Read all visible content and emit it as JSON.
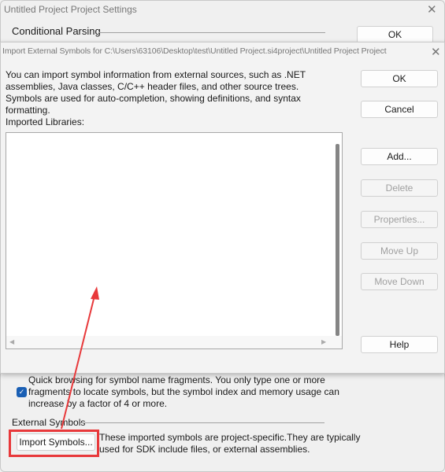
{
  "back_dialog": {
    "title": "Untitled Project Project Settings",
    "section_conditional": "Conditional Parsing",
    "ok": "OK",
    "quick_browse_text": "Quick browsing for symbol name fragments.  You only type one or more fragments to locate symbols, but the symbol index and memory usage can increase by a factor of 4 or more.",
    "quick_browse_checked": true,
    "section_external": "External Symbols",
    "import_button": "Import Symbols...",
    "import_desc": "These imported symbols are project-specific.They are typically used for SDK include files, or external assemblies."
  },
  "front_dialog": {
    "title": "Import External Symbols for C:\\Users\\63106\\Desktop\\test\\Untitled Project.si4project\\Untitled Project Project",
    "description": "You can import symbol information from external sources, such as .NET assemblies, Java classes, C/C++ header files, and other source trees. Symbols are used for auto-completion, showing definitions, and syntax formatting.",
    "libraries_label": "Imported Libraries:",
    "libraries": [],
    "buttons": {
      "ok": "OK",
      "cancel": "Cancel",
      "add": "Add...",
      "delete": "Delete",
      "properties": "Properties...",
      "move_up": "Move Up",
      "move_down": "Move Down",
      "help": "Help"
    }
  },
  "annotation": {
    "color": "#e8393b"
  }
}
